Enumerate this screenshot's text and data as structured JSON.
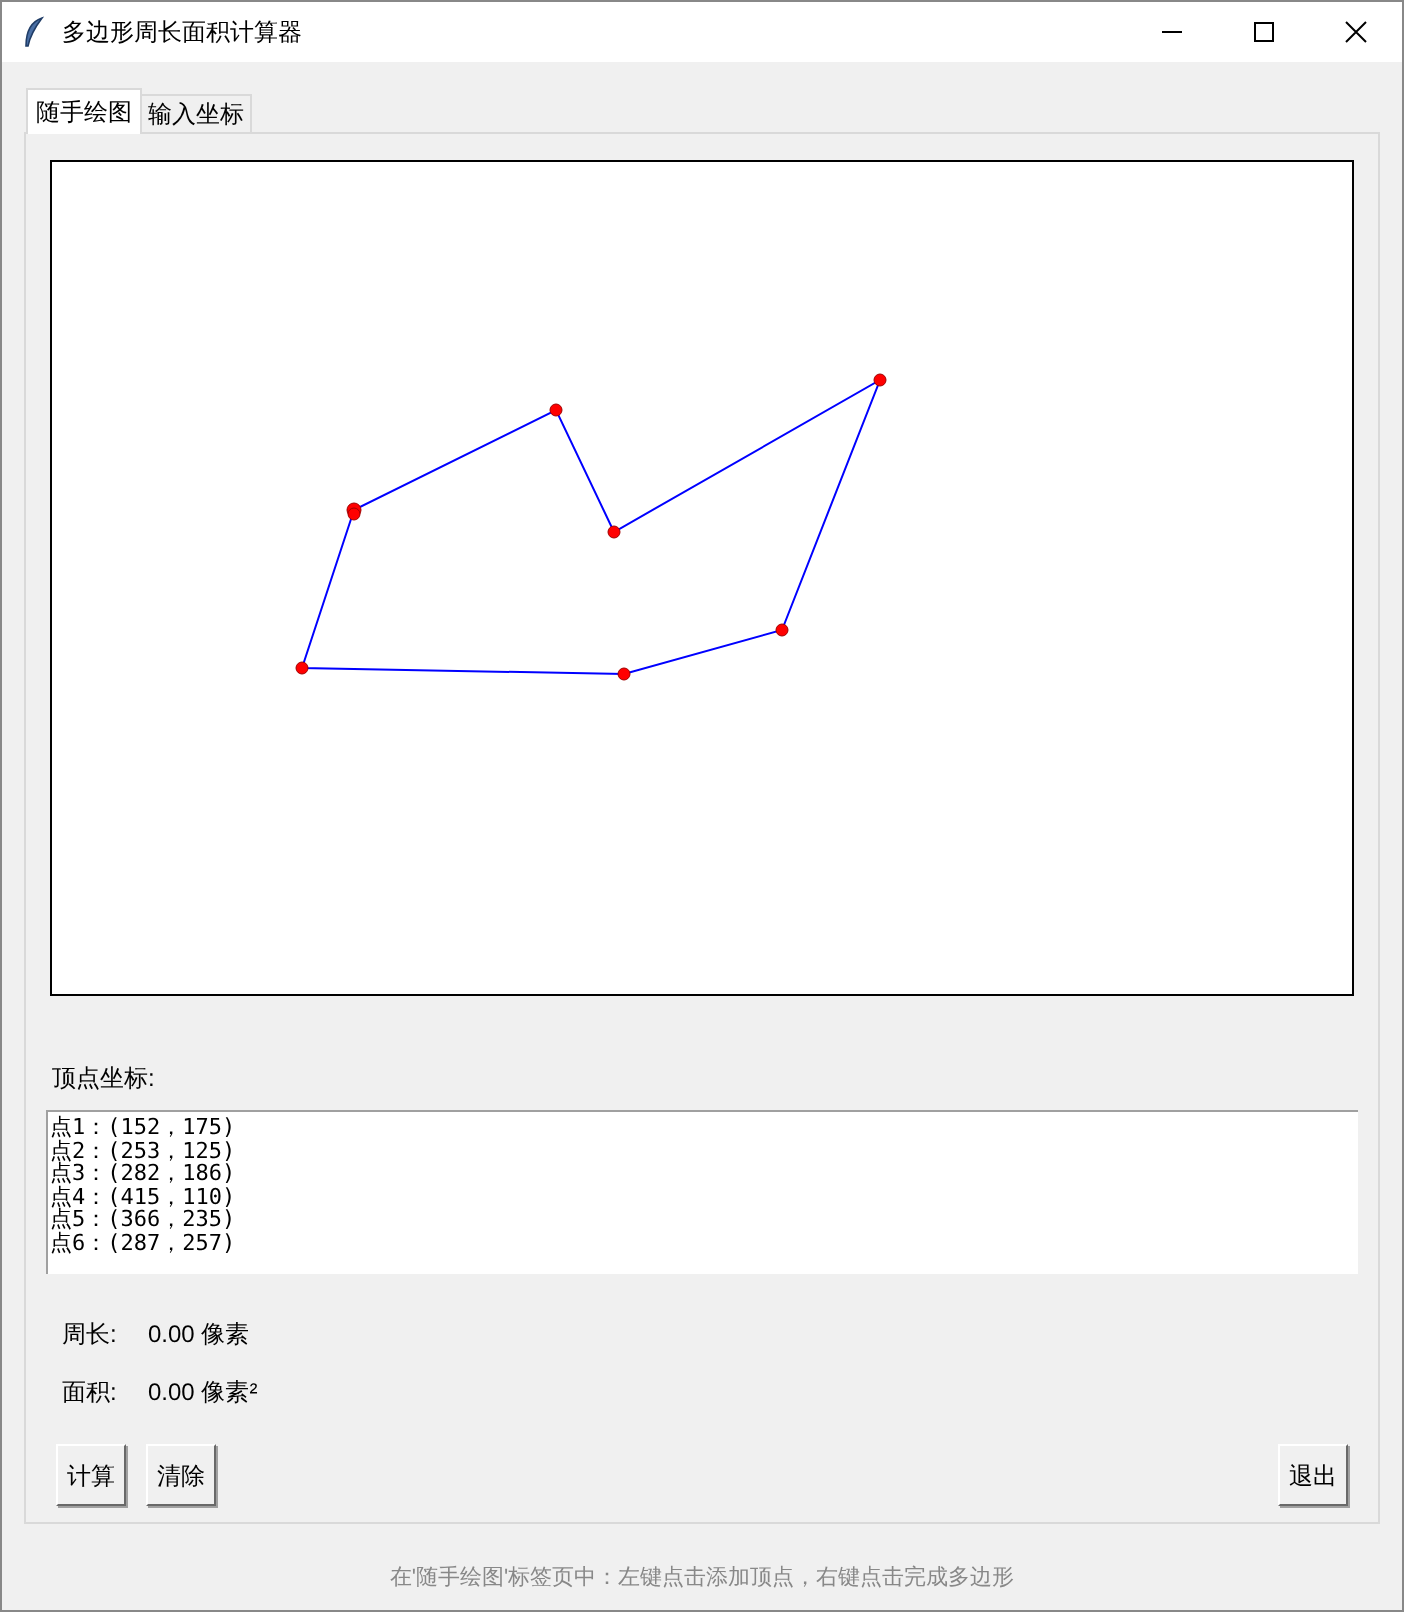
{
  "window": {
    "title": "多边形周长面积计算器"
  },
  "tabs": [
    {
      "label": "随手绘图",
      "selected": true
    },
    {
      "label": "输入坐标",
      "selected": false
    }
  ],
  "vertices": {
    "label": "顶点坐标:",
    "lines": [
      "点1：(152，175)",
      "点2：(253，125)",
      "点3：(282，186)",
      "点4：(415，110)",
      "点5：(366，235)",
      "点6：(287，257)"
    ]
  },
  "results": [
    {
      "label": "周长:",
      "value": "0.00 像素"
    },
    {
      "label": "面积:",
      "value": "0.00 像素²"
    }
  ],
  "buttons": {
    "left": [
      "计算",
      "清除"
    ],
    "right": [
      "退出"
    ]
  },
  "status": "在'随手绘图'标签页中：左键点击添加顶点，右键点击完成多边形"
}
